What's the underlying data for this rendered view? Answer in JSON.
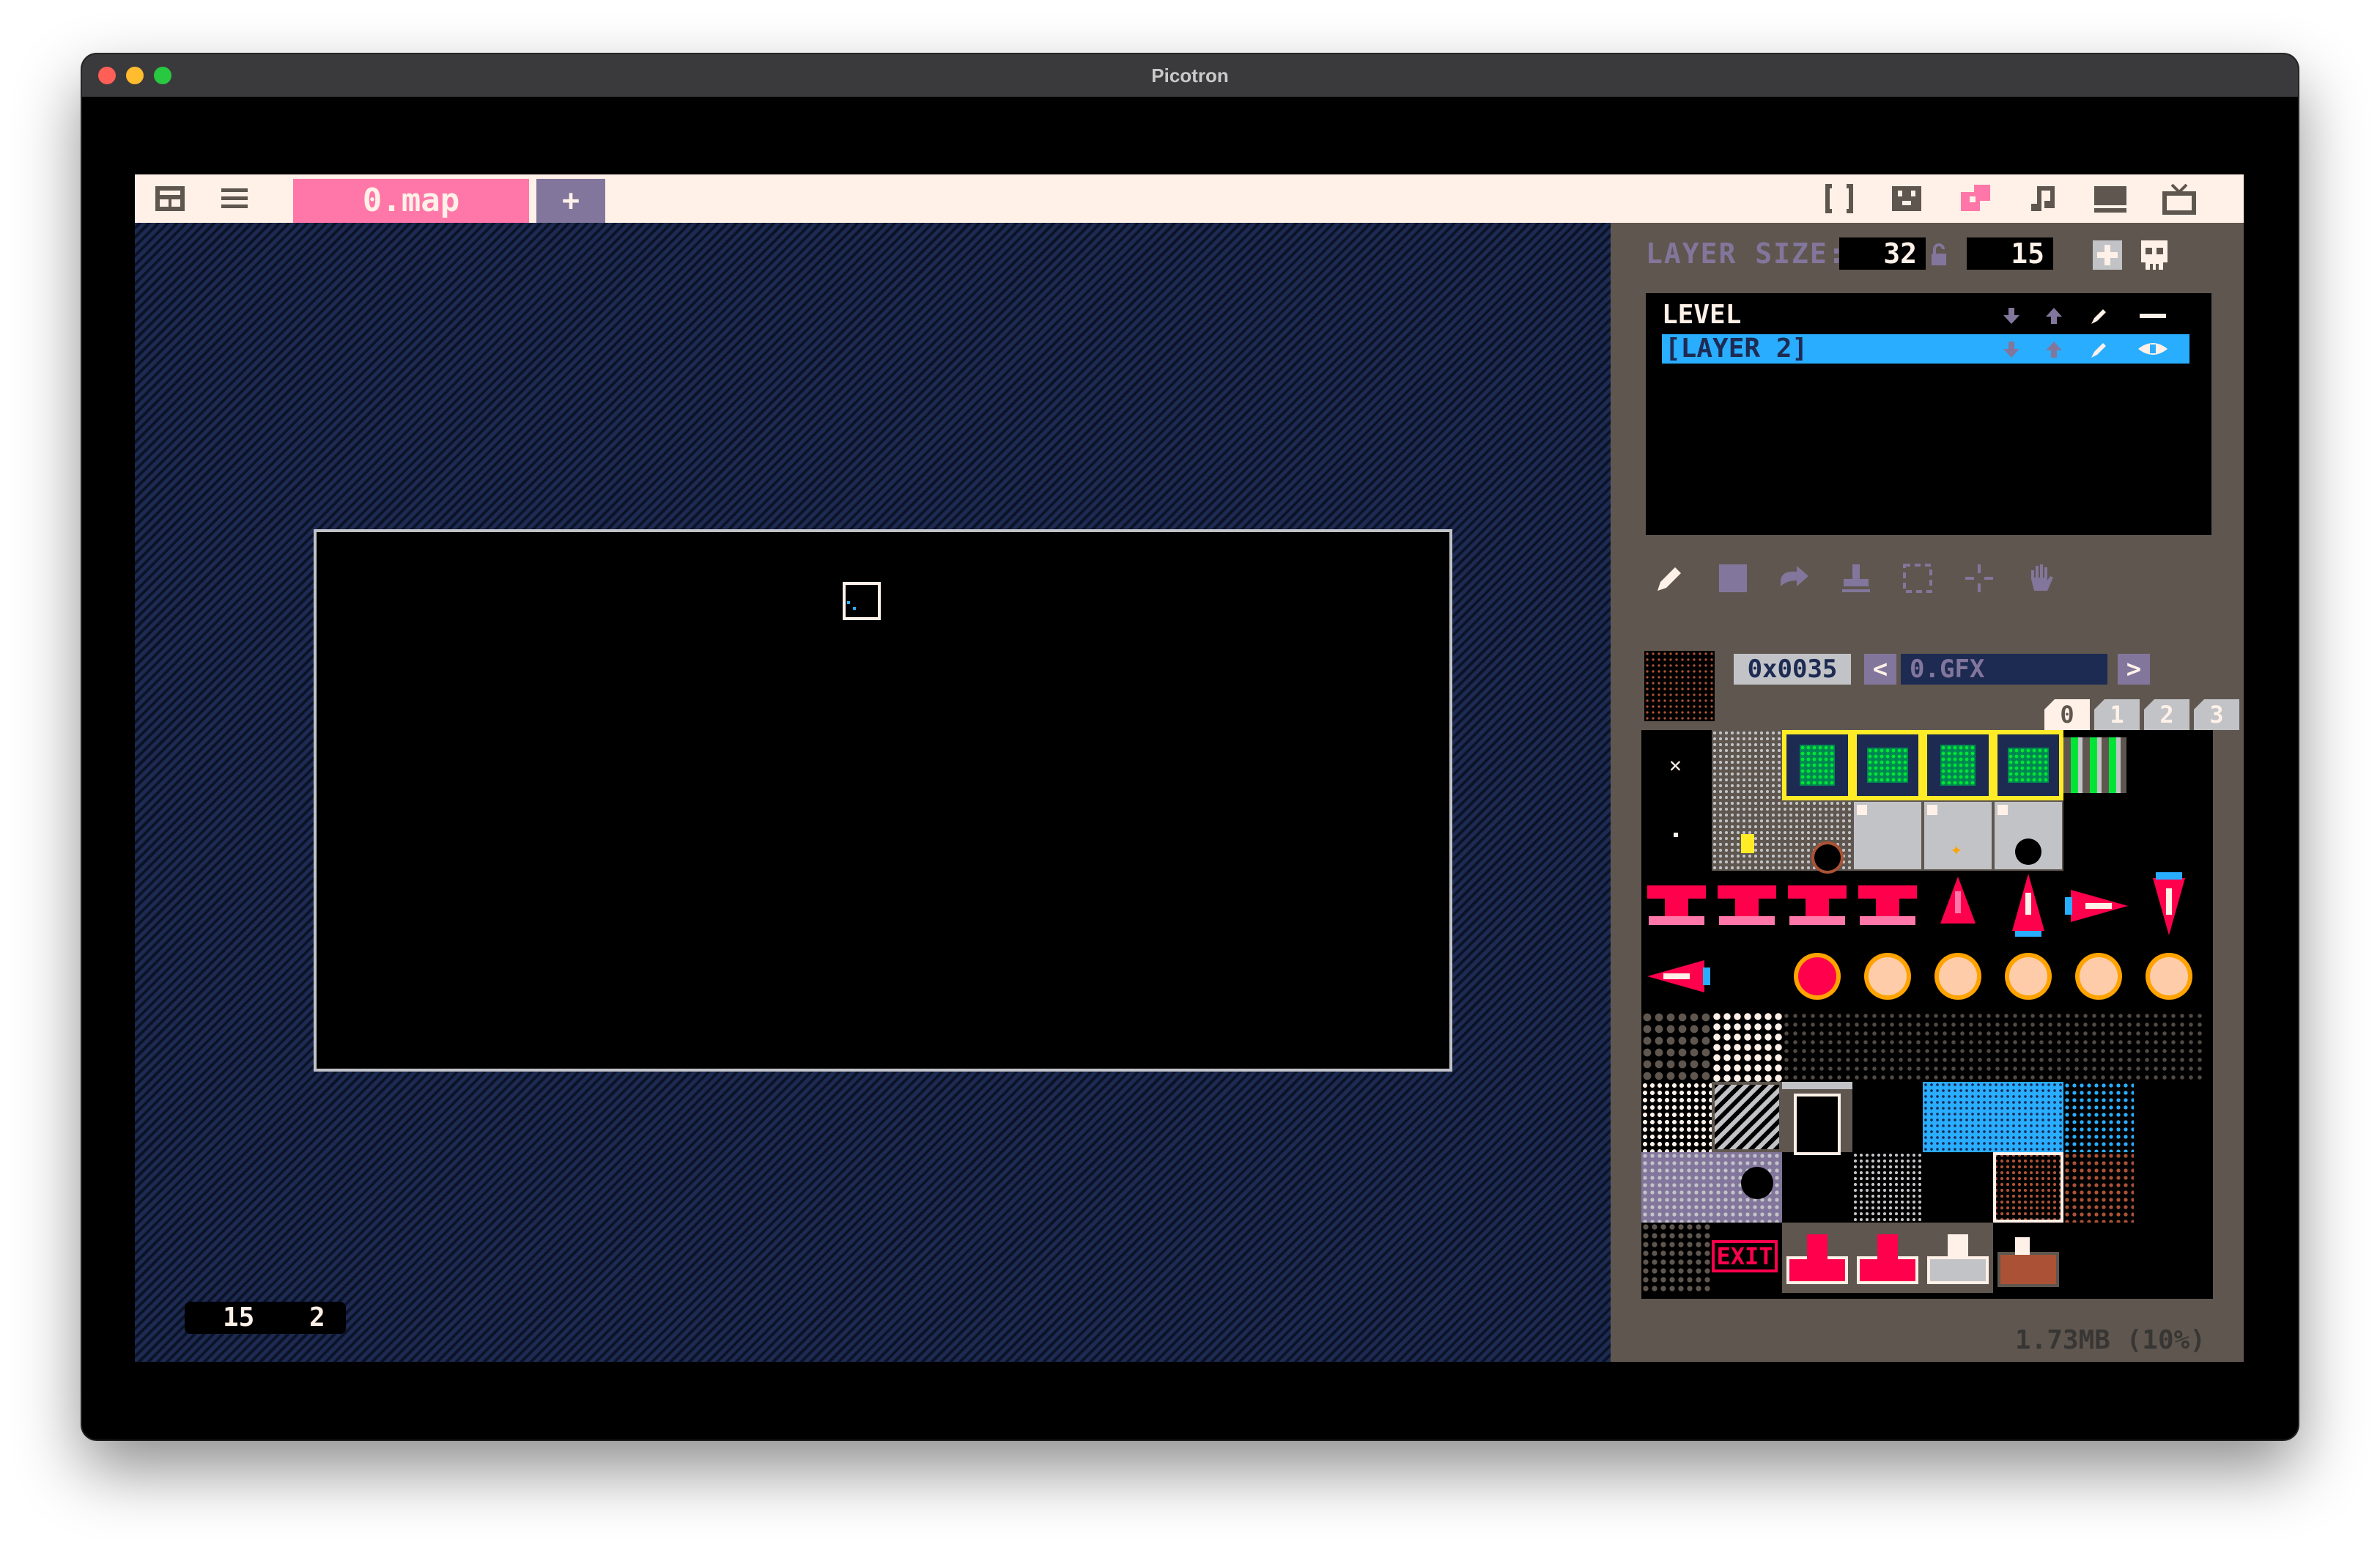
{
  "window": {
    "title": "Picotron",
    "traffic_lights": {
      "close": "#ff5f57",
      "minimize": "#febc2e",
      "maximize": "#28c840"
    }
  },
  "workspace_bar": {
    "left_icons": [
      "workspace-switch-icon",
      "menu-icon"
    ],
    "file_tab": "0.map",
    "add_tab_label": "+",
    "right_icons": [
      "code-editor-icon",
      "sprite-editor-icon",
      "map-editor-icon",
      "music-editor-icon",
      "desktop-icon",
      "tv-icon"
    ],
    "accent": "#ff77a8"
  },
  "map": {
    "coords": {
      "x": "15",
      "y": "2"
    }
  },
  "sidebar": {
    "layer_size_label": "LAYER SIZE:",
    "layer_width": "32",
    "layer_height": "15",
    "layers": [
      {
        "name": "LEVEL",
        "selected": false
      },
      {
        "name": "[LAYER 2]",
        "selected": true
      }
    ],
    "tools": [
      "pencil-tool-icon",
      "rectangle-tool-icon",
      "fill-tool-icon",
      "stamp-tool-icon",
      "select-tool-icon",
      "pan-tool-icon",
      "hand-tool-icon"
    ],
    "sprite_id": "0x0035",
    "gfx_prev": "<",
    "gfx_file": "0.GFX",
    "gfx_next": ">",
    "palette_tabs": [
      "0",
      "1",
      "2",
      "3"
    ],
    "exit_label": "EXIT",
    "memory": "1.73MB (10%)"
  }
}
